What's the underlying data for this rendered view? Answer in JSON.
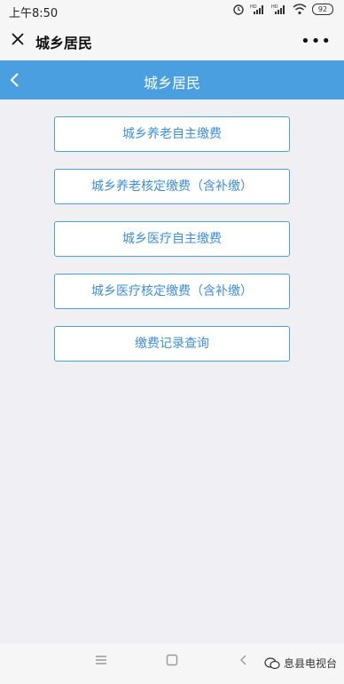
{
  "statusbar": {
    "time": "上午8:50",
    "battery": "92",
    "icons": [
      "alarm-icon",
      "hd-signal-icon",
      "hd-signal-icon",
      "wifi-icon",
      "battery-icon"
    ]
  },
  "wechat_bar": {
    "title": "城乡居民",
    "more": "•••"
  },
  "page": {
    "title": "城乡居民"
  },
  "menu": {
    "items": [
      {
        "label": "城乡养老自主缴费"
      },
      {
        "label": "城乡养老核定缴费（含补缴）"
      },
      {
        "label": "城乡医疗自主缴费"
      },
      {
        "label": "城乡医疗核定缴费（含补缴）"
      },
      {
        "label": "缴费记录查询"
      }
    ]
  },
  "navbar": {
    "menu_icon": "≡",
    "home_icon": "□",
    "back_icon": "‹"
  },
  "watermark": {
    "text": "息县电视台"
  },
  "colors": {
    "accent": "#4a9fe0",
    "button_text": "#3f8fd8",
    "background": "#efeff4"
  }
}
